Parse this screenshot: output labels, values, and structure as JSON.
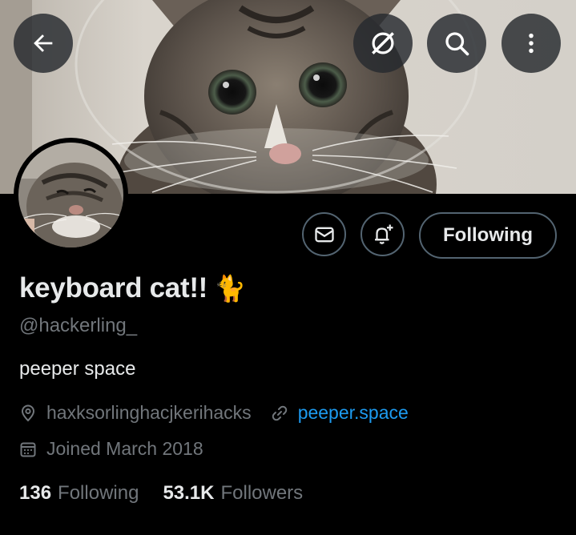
{
  "profile": {
    "display_name": "keyboard cat!!",
    "name_emoji": "🐈",
    "handle": "@hackerling_",
    "bio": "peeper space",
    "location": "haxksorlinghacjkerihacks",
    "website": "peeper.space",
    "joined": "Joined March 2018"
  },
  "stats": {
    "following_count": "136",
    "following_label": "Following",
    "followers_count": "53.1K",
    "followers_label": "Followers"
  },
  "actions": {
    "following_button": "Following"
  },
  "icons": {
    "back": "back-arrow-icon",
    "grok": "grok-icon",
    "search": "search-icon",
    "more": "more-vertical-icon",
    "message": "envelope-icon",
    "notify": "bell-plus-icon",
    "location": "location-pin-icon",
    "link": "link-icon",
    "calendar": "calendar-icon"
  },
  "colors": {
    "background": "#000000",
    "text_primary": "#e7e9ea",
    "text_secondary": "#71767b",
    "link": "#1d9bf0",
    "border": "#536471"
  }
}
